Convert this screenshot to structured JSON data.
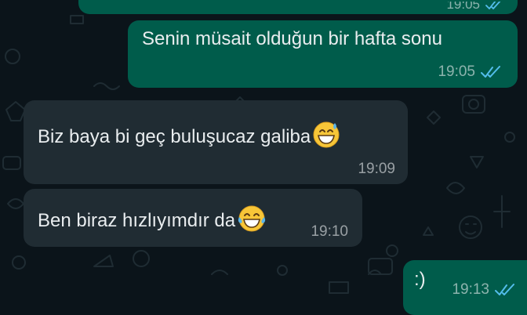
{
  "messages": [
    {
      "direction": "outgoing",
      "text": "",
      "time": "19:05",
      "read": true
    },
    {
      "direction": "outgoing",
      "text": "Senin müsait olduğun bir hafta sonu",
      "time": "19:05",
      "read": true
    },
    {
      "direction": "incoming",
      "text": "Biz baya bi geç buluşucaz galiba",
      "emoji": "grinning-face-with-sweat",
      "time": "19:09"
    },
    {
      "direction": "incoming",
      "text": "Ben biraz hızlıyımdır da",
      "emoji": "face-with-tears-of-joy",
      "time": "19:10"
    },
    {
      "direction": "outgoing",
      "text": ":)",
      "time": "19:13",
      "read": true
    }
  ],
  "colors": {
    "background": "#0b141a",
    "outgoing_bubble": "#005c4b",
    "incoming_bubble": "#202c33",
    "read_ticks": "#53bdeb"
  }
}
